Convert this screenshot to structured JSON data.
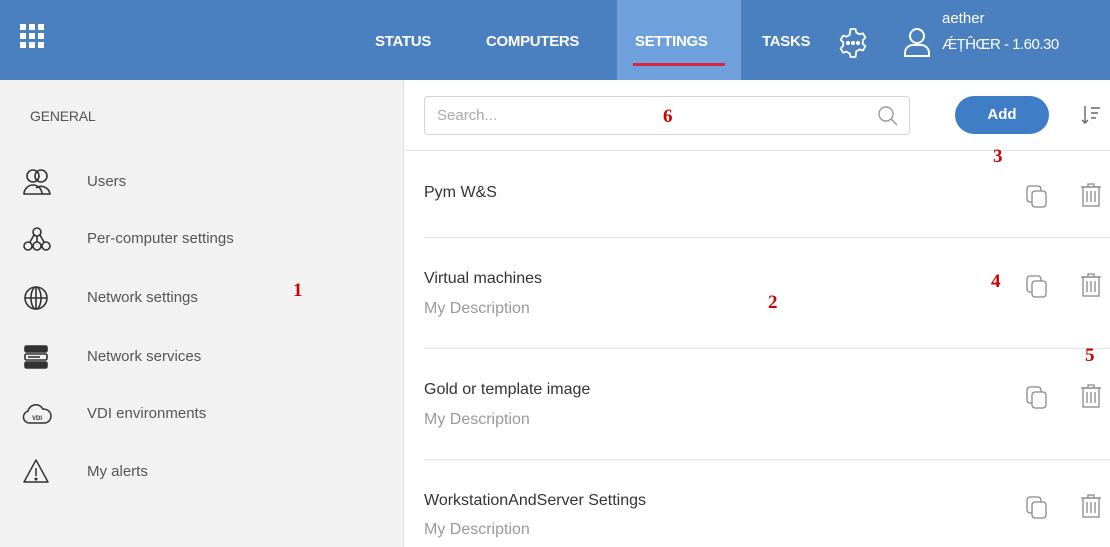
{
  "topbar": {
    "tabs": [
      {
        "label": "STATUS"
      },
      {
        "label": "COMPUTERS"
      },
      {
        "label": "SETTINGS"
      },
      {
        "label": "TASKS"
      }
    ],
    "active_tab": "SETTINGS",
    "icons": {
      "apps": "grid-icon",
      "settings": "gear-icon",
      "user": "user-icon"
    },
    "user": {
      "name": "aether",
      "version": "ǼȚĤŒR - 1.60.30"
    },
    "colors": {
      "bar": "#4a7fc0",
      "active_tab": "#6ea1db",
      "underline": "#d7263d"
    }
  },
  "sidebar": {
    "heading": "GENERAL",
    "items": [
      {
        "label": "Users",
        "icon": "users-icon"
      },
      {
        "label": "Per-computer settings",
        "icon": "hierarchy-icon"
      },
      {
        "label": "Network settings",
        "icon": "globe-icon"
      },
      {
        "label": "Network services",
        "icon": "server-icon"
      },
      {
        "label": "VDI environments",
        "icon": "vdi-cloud-icon"
      },
      {
        "label": "My alerts",
        "icon": "warning-icon"
      }
    ]
  },
  "main": {
    "search": {
      "placeholder": "Search...",
      "value": ""
    },
    "add_label": "Add",
    "rows": [
      {
        "title": "Pym W&S",
        "description": ""
      },
      {
        "title": "Virtual machines",
        "description": "My Description"
      },
      {
        "title": "Gold or template image",
        "description": "My Description"
      },
      {
        "title": "WorkstationAndServer Settings",
        "description": "My Description"
      }
    ],
    "row_icons": {
      "copy": "copy-icon",
      "delete": "trash-icon"
    }
  },
  "annotations": [
    "1",
    "2",
    "3",
    "4",
    "5",
    "6"
  ],
  "colors": {
    "accent": "#3f7ec6",
    "marker": "#cc0000",
    "sidebar_bg": "#f2f2f2"
  }
}
